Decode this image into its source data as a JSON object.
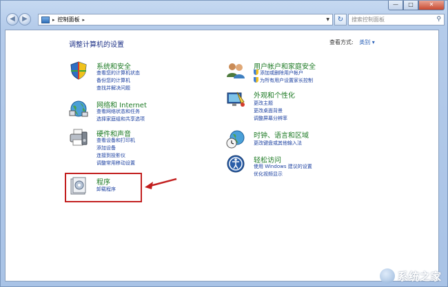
{
  "window": {
    "minimize_glyph": "—",
    "maximize_glyph": "□",
    "close_glyph": "✕"
  },
  "nav": {
    "back_glyph": "◀",
    "forward_glyph": "▶",
    "address_arrow": "▸",
    "breadcrumb": "控制面板",
    "breadcrumb_sep": "▸",
    "refresh_glyph": "↻"
  },
  "search": {
    "placeholder": "搜索控制面板",
    "icon": "search-icon"
  },
  "content": {
    "title": "调整计算机的设置",
    "view_by_label": "查看方式:",
    "view_by_value": "类别 ▾"
  },
  "categories": {
    "security": {
      "title": "系统和安全",
      "links": [
        "查看您的计算机状态",
        "备份您的计算机",
        "查找并解决问题"
      ]
    },
    "network": {
      "title": "网络和 Internet",
      "links": [
        "查看网络状态和任务",
        "选择家庭组和共享选项"
      ]
    },
    "hardware": {
      "title": "硬件和声音",
      "links": [
        "查看设备和打印机",
        "添加设备",
        "连接到投影仪",
        "调整常用移动设置"
      ]
    },
    "programs": {
      "title": "程序",
      "links": [
        "卸载程序"
      ]
    },
    "users": {
      "title": "用户帐户和家庭安全",
      "links": [
        "添加或删除用户帐户",
        "为所有用户设置家长控制"
      ]
    },
    "appearance": {
      "title": "外观和个性化",
      "links": [
        "更改主题",
        "更改桌面背景",
        "调整屏幕分辨率"
      ]
    },
    "clock": {
      "title": "时钟、语言和区域",
      "links": [
        "更改键盘或其他输入法"
      ]
    },
    "ease": {
      "title": "轻松访问",
      "links": [
        "使用 Windows 建议的设置",
        "优化视频显示"
      ]
    }
  },
  "watermark": "系统之家",
  "colors": {
    "highlight": "#c21e1e",
    "heading_green": "#1d7a24",
    "link_blue": "#1a3fa0"
  }
}
